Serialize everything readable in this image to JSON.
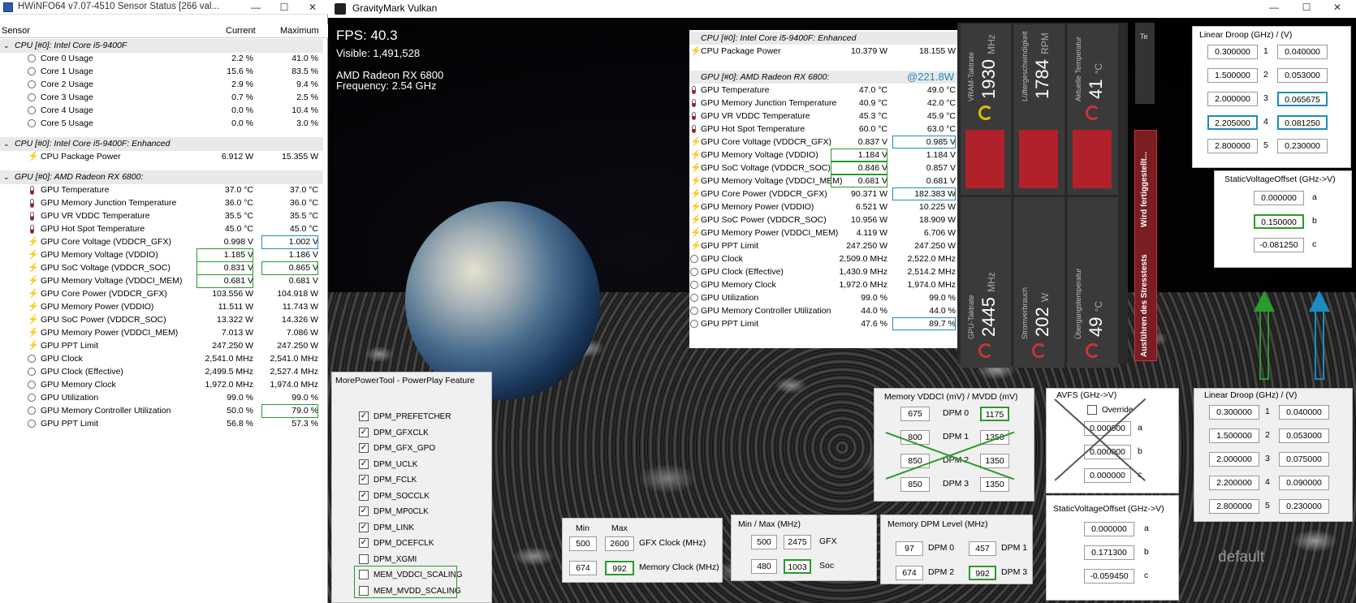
{
  "hwinfo": {
    "title": "HWiNFO64 v7.07-4510 Sensor Status [266 val...",
    "win_min": "—",
    "win_max": "☐",
    "win_close": "✕",
    "cols": {
      "sensor": "Sensor",
      "current": "Current",
      "maximum": "Maximum"
    },
    "groups": [
      {
        "title": "CPU [#0]: Intel Core i5-9400F",
        "rows": [
          {
            "label": "Core 0 Usage",
            "icon": "circle",
            "cur": "2.2 %",
            "max": "41.0 %"
          },
          {
            "label": "Core 1 Usage",
            "icon": "circle",
            "cur": "15.6 %",
            "max": "83.5 %"
          },
          {
            "label": "Core 2 Usage",
            "icon": "circle",
            "cur": "2.9 %",
            "max": "9.4 %"
          },
          {
            "label": "Core 3 Usage",
            "icon": "circle",
            "cur": "0.7 %",
            "max": "2.5 %"
          },
          {
            "label": "Core 4 Usage",
            "icon": "circle",
            "cur": "0.0 %",
            "max": "10.4 %"
          },
          {
            "label": "Core 5 Usage",
            "icon": "circle",
            "cur": "0.0 %",
            "max": "3.0 %"
          }
        ]
      },
      {
        "title": "CPU [#0]: Intel Core i5-9400F: Enhanced",
        "rows": [
          {
            "label": "CPU Package Power",
            "icon": "bolt",
            "cur": "6.912 W",
            "max": "15.355 W"
          }
        ]
      },
      {
        "title": "GPU [#0]: AMD Radeon RX 6800:",
        "rows": [
          {
            "label": "GPU Temperature",
            "icon": "therm",
            "cur": "37.0 °C",
            "max": "37.0 °C"
          },
          {
            "label": "GPU Memory Junction Temperature",
            "icon": "therm",
            "cur": "36.0 °C",
            "max": "36.0 °C"
          },
          {
            "label": "GPU VR VDDC Temperature",
            "icon": "therm",
            "cur": "35.5 °C",
            "max": "35.5 °C"
          },
          {
            "label": "GPU Hot Spot Temperature",
            "icon": "therm",
            "cur": "45.0 °C",
            "max": "45.0 °C"
          },
          {
            "label": "GPU Core Voltage (VDDCR_GFX)",
            "icon": "bolt",
            "cur": "0.998 V",
            "max": "1.002 V",
            "hl_max": "b"
          },
          {
            "label": "GPU Memory Voltage (VDDIO)",
            "icon": "bolt",
            "cur": "1.185 V",
            "max": "1.186 V",
            "hl_cur": "g"
          },
          {
            "label": "GPU SoC Voltage (VDDCR_SOC)",
            "icon": "bolt",
            "cur": "0.831 V",
            "max": "0.865 V",
            "hl_cur": "g",
            "hl_max": "g"
          },
          {
            "label": "GPU Memory Voltage (VDDCI_MEM)",
            "icon": "bolt",
            "cur": "0.681 V",
            "max": "0.681 V",
            "hl_cur": "g"
          },
          {
            "label": "GPU Core Power (VDDCR_GFX)",
            "icon": "bolt",
            "cur": "103.556 W",
            "max": "104.918 W"
          },
          {
            "label": "GPU Memory Power (VDDIO)",
            "icon": "bolt",
            "cur": "11.511 W",
            "max": "11.743 W"
          },
          {
            "label": "GPU SoC Power (VDDCR_SOC)",
            "icon": "bolt",
            "cur": "13.322 W",
            "max": "14.326 W"
          },
          {
            "label": "GPU Memory Power (VDDCI_MEM)",
            "icon": "bolt",
            "cur": "7.013 W",
            "max": "7.086 W"
          },
          {
            "label": "GPU PPT Limit",
            "icon": "bolt",
            "cur": "247.250 W",
            "max": "247.250 W"
          },
          {
            "label": "GPU Clock",
            "icon": "circle",
            "cur": "2,541.0 MHz",
            "max": "2,541.0 MHz"
          },
          {
            "label": "GPU Clock (Effective)",
            "icon": "circle",
            "cur": "2,499.5 MHz",
            "max": "2,527.4 MHz"
          },
          {
            "label": "GPU Memory Clock",
            "icon": "circle",
            "cur": "1,972.0 MHz",
            "max": "1,974.0 MHz"
          },
          {
            "label": "GPU Utilization",
            "icon": "circle",
            "cur": "99.0 %",
            "max": "99.0 %"
          },
          {
            "label": "GPU Memory Controller Utilization",
            "icon": "circle",
            "cur": "50.0 %",
            "max": "79.0 %",
            "hl_max": "g"
          },
          {
            "label": "GPU PPT Limit",
            "icon": "circle",
            "cur": "56.8 %",
            "max": "57.3 %"
          }
        ]
      }
    ]
  },
  "gravitymark": {
    "title": "GravityMark Vulkan",
    "fps": "FPS: 40.3",
    "visible": "Visible: 1,491,528",
    "gpu": "AMD Radeon RX 6800",
    "frequency": "Frequency: 2.54 GHz"
  },
  "overlay": {
    "groups": [
      {
        "title": "CPU [#0]: Intel Core i5-9400F: Enhanced",
        "rows": [
          {
            "label": "CPU Package Power",
            "icon": "bolt",
            "cur": "10.379 W",
            "max": "18.155 W"
          }
        ]
      },
      {
        "title": "GPU [#0]: AMD Radeon RX 6800:",
        "power": "@221.8W",
        "rows": [
          {
            "label": "GPU Temperature",
            "icon": "therm",
            "cur": "47.0 °C",
            "max": "49.0 °C"
          },
          {
            "label": "GPU Memory Junction Temperature",
            "icon": "therm",
            "cur": "40.9 °C",
            "max": "42.0 °C"
          },
          {
            "label": "GPU VR VDDC Temperature",
            "icon": "therm",
            "cur": "45.3 °C",
            "max": "45.9 °C"
          },
          {
            "label": "GPU Hot Spot Temperature",
            "icon": "therm",
            "cur": "60.0 °C",
            "max": "63.0 °C"
          },
          {
            "label": "GPU Core Voltage (VDDCR_GFX)",
            "icon": "bolt",
            "cur": "0.837 V",
            "max": "0.985 V",
            "hl_max": "b"
          },
          {
            "label": "GPU Memory Voltage (VDDIO)",
            "icon": "bolt",
            "cur": "1.184 V",
            "max": "1.184 V",
            "hl_cur": "g"
          },
          {
            "label": "GPU SoC Voltage (VDDCR_SOC)",
            "icon": "bolt",
            "cur": "0.846 V",
            "max": "0.857 V",
            "hl_cur": "g"
          },
          {
            "label": "GPU Memory Voltage (VDDCI_MEM)",
            "icon": "bolt",
            "cur": "0.681 V",
            "max": "0.681 V",
            "hl_cur": "g"
          },
          {
            "label": "GPU Core Power (VDDCR_GFX)",
            "icon": "bolt",
            "cur": "90.371 W",
            "max": "182.383 W",
            "hl_max": "b"
          },
          {
            "label": "GPU Memory Power (VDDIO)",
            "icon": "bolt",
            "cur": "6.521 W",
            "max": "10.225 W"
          },
          {
            "label": "GPU SoC Power (VDDCR_SOC)",
            "icon": "bolt",
            "cur": "10.956 W",
            "max": "18.909 W"
          },
          {
            "label": "GPU Memory Power (VDDCI_MEM)",
            "icon": "bolt",
            "cur": "4.119 W",
            "max": "6.706 W"
          },
          {
            "label": "GPU PPT Limit",
            "icon": "bolt",
            "cur": "247.250 W",
            "max": "247.250 W"
          },
          {
            "label": "GPU Clock",
            "icon": "circle",
            "cur": "2,509.0 MHz",
            "max": "2,522.0 MHz"
          },
          {
            "label": "GPU Clock (Effective)",
            "icon": "circle",
            "cur": "1,430.9 MHz",
            "max": "2,514.2 MHz"
          },
          {
            "label": "GPU Memory Clock",
            "icon": "circle",
            "cur": "1,972.0 MHz",
            "max": "1,974.0 MHz"
          },
          {
            "label": "GPU Utilization",
            "icon": "circle",
            "cur": "99.0 %",
            "max": "99.0 %"
          },
          {
            "label": "GPU Memory Controller Utilization",
            "icon": "circle",
            "cur": "44.0 %",
            "max": "44.0 %"
          },
          {
            "label": "GPU PPT Limit",
            "icon": "circle",
            "cur": "47.6 %",
            "max": "89.7 %",
            "hl_max": "b"
          }
        ]
      }
    ]
  },
  "amd": {
    "vram_clock": {
      "value": "1930",
      "unit": "MHz",
      "label": "VRAM-Taktrate"
    },
    "fan": {
      "value": "1784",
      "unit": "RPM",
      "label": "Lüftergeschwindigkeit"
    },
    "temp": {
      "value": "41",
      "unit": "°C",
      "label": "Aktuelle Temperatur"
    },
    "gpu_clock": {
      "value": "2445",
      "unit": "MHz",
      "label": "GPU-Taktrate"
    },
    "power": {
      "value": "202",
      "unit": "W",
      "label": "Stromverbrauch"
    },
    "junction": {
      "value": "49",
      "unit": "°C",
      "label": "Übergangstemperatur"
    },
    "stress_label": "Ausführen des Stresstests",
    "stress_done": "Wird fertiggestellt...",
    "edge_label": "Te"
  },
  "linear_droop_top": {
    "title": "Linear Droop (GHz) / (V)",
    "rows": [
      {
        "ghz": "0.300000",
        "idx": "1",
        "v": "0.040000"
      },
      {
        "ghz": "1.500000",
        "idx": "2",
        "v": "0.053000"
      },
      {
        "ghz": "2.000000",
        "idx": "3",
        "v": "0.065675",
        "hl_v": "b"
      },
      {
        "ghz": "2.205000",
        "idx": "4",
        "v": "0.081250",
        "hl_ghz": "b",
        "hl_v": "b"
      },
      {
        "ghz": "2.800000",
        "idx": "5",
        "v": "0.230000"
      }
    ]
  },
  "static_offset_top": {
    "title": "StaticVoltageOffset (GHz->V)",
    "rows": [
      {
        "val": "0.000000",
        "lbl": "a"
      },
      {
        "val": "0.150000",
        "lbl": "b",
        "hl": "g"
      },
      {
        "val": "-0.081250",
        "lbl": "c"
      }
    ]
  },
  "mpt": {
    "title": "MorePowerTool - PowerPlay Feature",
    "items": [
      {
        "label": "DPM_PREFETCHER",
        "checked": true
      },
      {
        "label": "DPM_GFXCLK",
        "checked": true
      },
      {
        "label": "DPM_GFX_GPO",
        "checked": true
      },
      {
        "label": "DPM_UCLK",
        "checked": true
      },
      {
        "label": "DPM_FCLK",
        "checked": true
      },
      {
        "label": "DPM_SOCCLK",
        "checked": true
      },
      {
        "label": "DPM_MP0CLK",
        "checked": true
      },
      {
        "label": "DPM_LINK",
        "checked": true
      },
      {
        "label": "DPM_DCEFCLK",
        "checked": true
      },
      {
        "label": "DPM_XGMI",
        "checked": false
      },
      {
        "label": "MEM_VDDCI_SCALING",
        "checked": false
      },
      {
        "label": "MEM_MVDD_SCALING",
        "checked": false
      }
    ]
  },
  "clocks": {
    "min_label": "Min",
    "max_label": "Max",
    "gfx": {
      "min": "500",
      "max": "2600",
      "label": "GFX Clock (MHz)"
    },
    "mem": {
      "min": "674",
      "max": "992",
      "label": "Memory Clock (MHz)"
    }
  },
  "minmax": {
    "title": "Min / Max (MHz)",
    "gfx": {
      "min": "500",
      "max": "2475",
      "label": "GFX"
    },
    "soc": {
      "min": "480",
      "max": "1003",
      "label": "Soc"
    }
  },
  "mem_dpm": {
    "title": "Memory DPM Level (MHz)",
    "dpm0": {
      "val": "97",
      "label": "DPM 0"
    },
    "dpm1": {
      "val": "457",
      "label": "DPM 1"
    },
    "dpm2": {
      "val": "674",
      "label": "DPM 2"
    },
    "dpm3": {
      "val": "992",
      "label": "DPM 3"
    }
  },
  "mem_vddci": {
    "title": "Memory VDDCI (mV) / MVDD (mV)",
    "rows": [
      {
        "vddci": "675",
        "label": "DPM 0",
        "mvdd": "1175",
        "hl": "g"
      },
      {
        "vddci": "800",
        "label": "DPM 1",
        "mvdd": "1350"
      },
      {
        "vddci": "850",
        "label": "DPM 2",
        "mvdd": "1350"
      },
      {
        "vddci": "850",
        "label": "DPM 3",
        "mvdd": "1350"
      }
    ]
  },
  "avfs": {
    "title": "AVFS (GHz->V)",
    "override": "Override",
    "rows": [
      {
        "val": "0.000000",
        "lbl": "a"
      },
      {
        "val": "0.000000",
        "lbl": "b"
      },
      {
        "val": "0.000000",
        "lbl": "c"
      }
    ]
  },
  "static_offset_bottom": {
    "title": "StaticVoltageOffset (GHz->V)",
    "rows": [
      {
        "val": "0.000000",
        "lbl": "a"
      },
      {
        "val": "0.171300",
        "lbl": "b"
      },
      {
        "val": "-0.059450",
        "lbl": "c"
      }
    ]
  },
  "linear_droop_bottom": {
    "title": "Linear Droop (GHz) / (V)",
    "rows": [
      {
        "ghz": "0.300000",
        "idx": "1",
        "v": "0.040000"
      },
      {
        "ghz": "1.500000",
        "idx": "2",
        "v": "0.053000"
      },
      {
        "ghz": "2.000000",
        "idx": "3",
        "v": "0.075000"
      },
      {
        "ghz": "2.200000",
        "idx": "4",
        "v": "0.090000"
      },
      {
        "ghz": "2.800000",
        "idx": "5",
        "v": "0.230000"
      }
    ]
  },
  "default_label": "default",
  "colors": {
    "green": "#2a9a2a",
    "blue": "#1f8ac0",
    "amd_red": "#b0212a"
  }
}
